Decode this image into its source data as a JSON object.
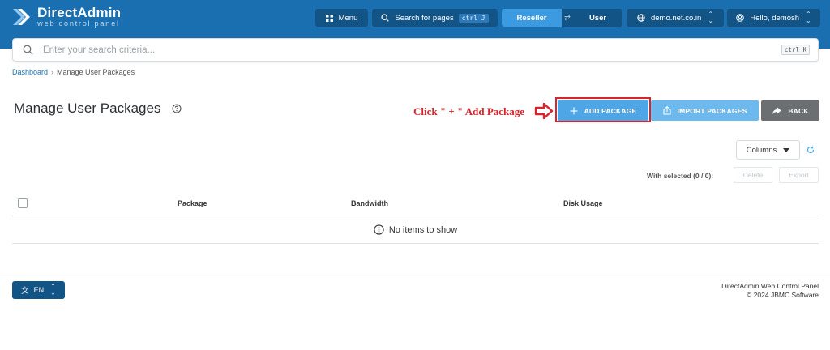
{
  "header": {
    "logo_title": "DirectAdmin",
    "logo_subtitle": "web control panel",
    "menu_label": "Menu",
    "search_label": "Search for pages",
    "search_shortcut": "ctrl J",
    "role_reseller": "Reseller",
    "role_user": "User",
    "domain": "demo.net.co.in",
    "greeting": "Hello, demosh"
  },
  "global_search": {
    "placeholder": "Enter your search criteria...",
    "shortcut": "ctrl K"
  },
  "breadcrumb": {
    "home": "Dashboard",
    "current": "Manage User Packages"
  },
  "page": {
    "title": "Manage User Packages",
    "annotation": "Click \" + \" Add Package"
  },
  "actions": {
    "add": "ADD PACKAGE",
    "import": "IMPORT PACKAGES",
    "back": "BACK"
  },
  "table_tools": {
    "columns_label": "Columns",
    "selected_label": "With selected (0 / 0):",
    "delete_label": "Delete",
    "export_label": "Export"
  },
  "table": {
    "columns": [
      "Package",
      "Bandwidth",
      "Disk Usage"
    ],
    "empty_message": "No items to show"
  },
  "footer": {
    "language": "EN",
    "product": "DirectAdmin Web Control Panel",
    "copyright": "© 2024 JBMC Software"
  },
  "colors": {
    "header_bg": "#1a6fb0",
    "accent": "#4ea6e6",
    "highlight": "#d6262c",
    "back_button": "#6c6f72"
  }
}
